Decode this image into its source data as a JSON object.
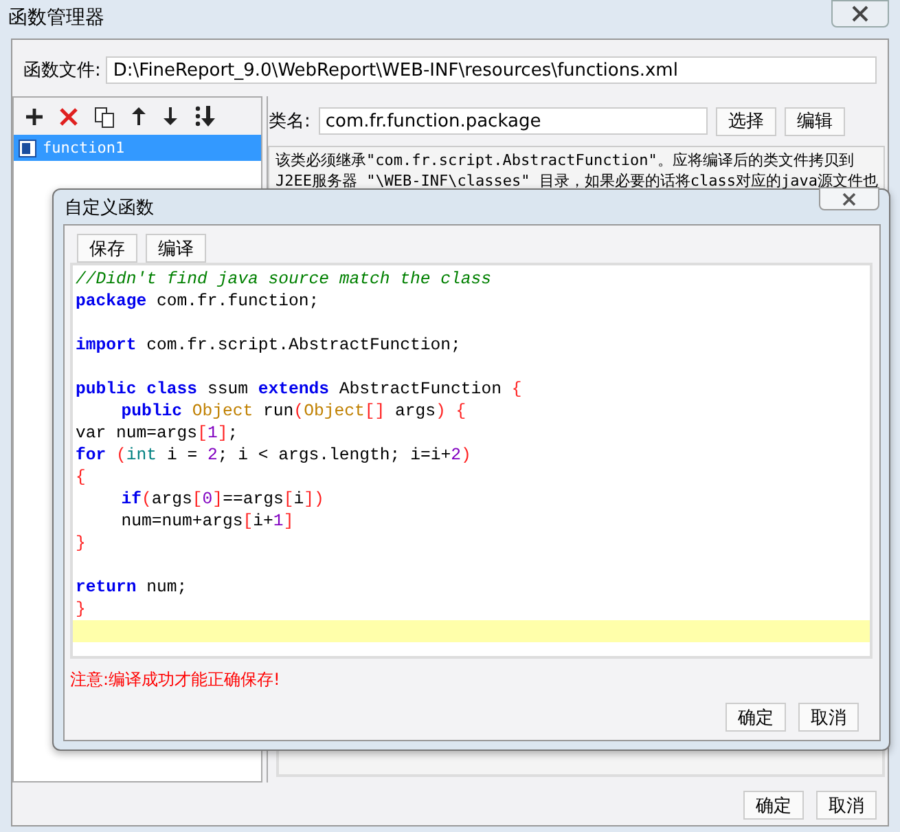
{
  "window": {
    "title": "函数管理器"
  },
  "file_row": {
    "label": "函数文件:",
    "value": "D:\\FineReport_9.0\\WebReport\\WEB-INF\\resources\\functions.xml"
  },
  "function_list": [
    {
      "name": "function1",
      "selected": true
    }
  ],
  "class_row": {
    "label": "类名:",
    "value": "com.fr.function.package",
    "buttons": [
      "选择",
      "编辑"
    ]
  },
  "description": [
    "该类必须继承\"com.fr.script.AbstractFunction\"。应将编译后的类文件拷贝到",
    "J2EE服务器 \"\\WEB-INF\\classes\" 目录，如果必要的话将class对应的java源文件也"
  ],
  "dialog": {
    "title": "自定义函数",
    "toolbar": [
      "保存",
      "编译"
    ],
    "code_lines": [
      {
        "kind": "code",
        "indented": false,
        "tokens": [
          {
            "kind": "comment",
            "text": "//Didn't find java source match the class"
          }
        ]
      },
      {
        "kind": "code",
        "indented": false,
        "tokens": [
          {
            "kind": "keyword",
            "text": "package"
          },
          {
            "kind": "plain",
            "text": " com.fr.function;"
          }
        ]
      },
      {
        "kind": "blank"
      },
      {
        "kind": "code",
        "indented": false,
        "tokens": [
          {
            "kind": "keyword",
            "text": "import"
          },
          {
            "kind": "plain",
            "text": " com.fr.script.AbstractFunction;"
          }
        ]
      },
      {
        "kind": "blank"
      },
      {
        "kind": "code",
        "indented": false,
        "tokens": [
          {
            "kind": "keyword",
            "text": "public class"
          },
          {
            "kind": "plain",
            "text": " ssum "
          },
          {
            "kind": "keyword",
            "text": "extends"
          },
          {
            "kind": "plain",
            "text": " AbstractFunction "
          },
          {
            "kind": "bracket",
            "text": "{"
          }
        ]
      },
      {
        "kind": "code",
        "indented": true,
        "tokens": [
          {
            "kind": "keyword",
            "text": "public "
          },
          {
            "kind": "type",
            "text": "Object"
          },
          {
            "kind": "plain",
            "text": " run"
          },
          {
            "kind": "bracket",
            "text": "("
          },
          {
            "kind": "type",
            "text": "Object"
          },
          {
            "kind": "bracket",
            "text": "[]"
          },
          {
            "kind": "plain",
            "text": " args"
          },
          {
            "kind": "bracket",
            "text": ") {"
          }
        ]
      },
      {
        "kind": "code",
        "indented": false,
        "tokens": [
          {
            "kind": "plain",
            "text": "var num=args"
          },
          {
            "kind": "bracket",
            "text": "["
          },
          {
            "kind": "number",
            "text": "1"
          },
          {
            "kind": "bracket",
            "text": "]"
          },
          {
            "kind": "plain",
            "text": ";"
          }
        ]
      },
      {
        "kind": "code",
        "indented": false,
        "tokens": [
          {
            "kind": "keyword",
            "text": "for "
          },
          {
            "kind": "bracket",
            "text": "("
          },
          {
            "kind": "primitive",
            "text": "int"
          },
          {
            "kind": "plain",
            "text": " i = "
          },
          {
            "kind": "number",
            "text": "2"
          },
          {
            "kind": "plain",
            "text": "; i < args.length; i=i+"
          },
          {
            "kind": "number",
            "text": "2"
          },
          {
            "kind": "bracket",
            "text": ")"
          }
        ]
      },
      {
        "kind": "code",
        "indented": false,
        "tokens": [
          {
            "kind": "bracket",
            "text": "{"
          }
        ]
      },
      {
        "kind": "code",
        "indented": true,
        "tokens": [
          {
            "kind": "keyword",
            "text": "if"
          },
          {
            "kind": "bracket",
            "text": "("
          },
          {
            "kind": "plain",
            "text": "args"
          },
          {
            "kind": "bracket",
            "text": "["
          },
          {
            "kind": "number",
            "text": "0"
          },
          {
            "kind": "bracket",
            "text": "]"
          },
          {
            "kind": "plain",
            "text": "==args"
          },
          {
            "kind": "bracket",
            "text": "["
          },
          {
            "kind": "plain",
            "text": "i"
          },
          {
            "kind": "bracket",
            "text": "])"
          }
        ]
      },
      {
        "kind": "code",
        "indented": true,
        "tokens": [
          {
            "kind": "plain",
            "text": "num=num+args"
          },
          {
            "kind": "bracket",
            "text": "["
          },
          {
            "kind": "plain",
            "text": "i+"
          },
          {
            "kind": "number",
            "text": "1"
          },
          {
            "kind": "bracket",
            "text": "]"
          }
        ]
      },
      {
        "kind": "code",
        "indented": false,
        "tokens": [
          {
            "kind": "bracket",
            "text": "}"
          }
        ]
      },
      {
        "kind": "blank"
      },
      {
        "kind": "code",
        "indented": false,
        "tokens": [
          {
            "kind": "keyword",
            "text": "return"
          },
          {
            "kind": "plain",
            "text": " num;"
          }
        ]
      },
      {
        "kind": "code",
        "indented": false,
        "tokens": [
          {
            "kind": "bracket",
            "text": "}"
          }
        ]
      },
      {
        "kind": "current"
      }
    ],
    "warning": "注意:编译成功才能正确保存!",
    "buttons": [
      "确定",
      "取消"
    ]
  },
  "buttons": [
    "确定",
    "取消"
  ]
}
